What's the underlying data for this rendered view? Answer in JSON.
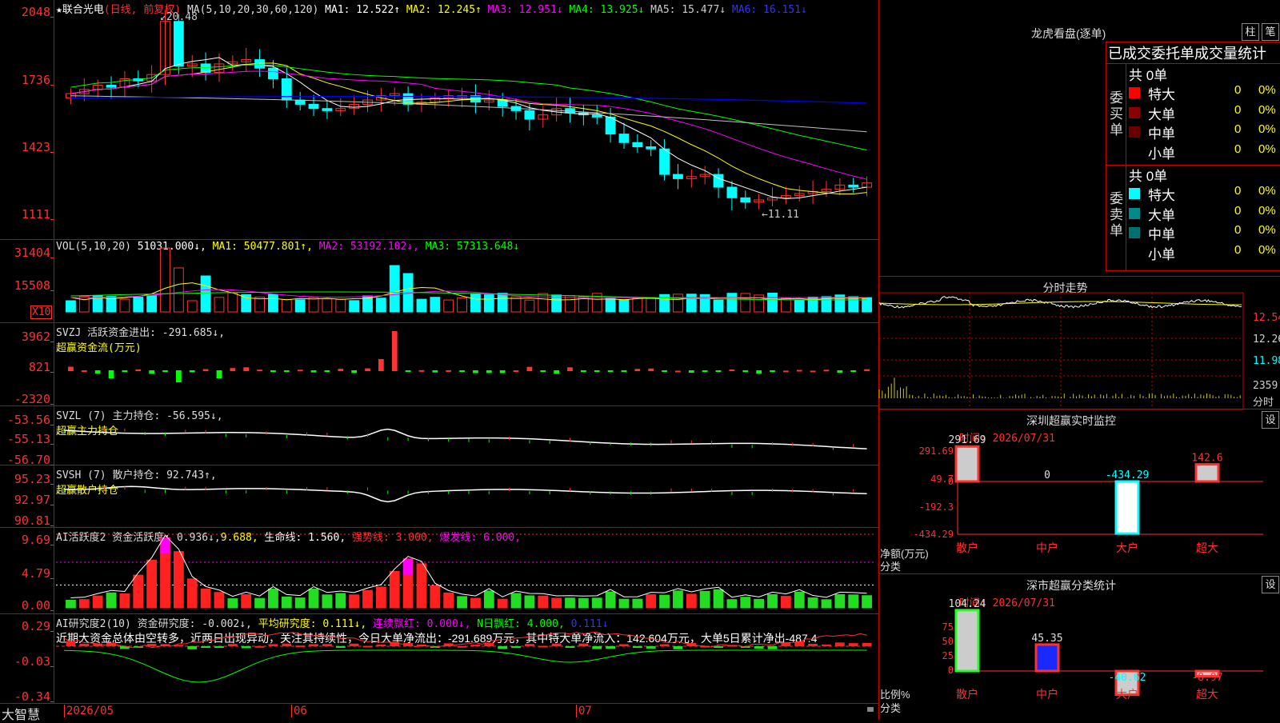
{
  "stock": {
    "name": "★联合光电",
    "period": "(日线, 前复权)",
    "ma_label": "MA(5,10,20,30,60,120)",
    "ma1": "MA1: 12.522↑",
    "ma2": "MA2: 12.245↑",
    "ma3": "MA3: 12.951↓",
    "ma4": "MA4: 13.925↓",
    "ma5": "MA5: 15.477↓",
    "ma6": "MA6: 16.151↓",
    "high_label": "20.48",
    "low_label": "11.11",
    "yticks": [
      "2048",
      "1736",
      "1423",
      "1111"
    ]
  },
  "vol": {
    "label": "VOL(5,10,20)",
    "value": "51031.000↓,",
    "ma1": "MA1: 50477.801↑,",
    "ma2": "MA2: 53192.102↓,",
    "ma3": "MA3: 57313.648↓",
    "yticks": [
      "31404",
      "15508"
    ],
    "unit": "X10"
  },
  "svzj": {
    "label": "SVZJ  活跃资金进出: -291.685↓,",
    "sub": "超赢资金流(万元)",
    "yticks": [
      "3962",
      "821",
      "-2320"
    ]
  },
  "svzl": {
    "label": "SVZL (7) 主力持仓: -56.595↓,",
    "sub": "超赢主力持仓",
    "yticks": [
      "-53.56",
      "-55.13",
      "-56.70"
    ]
  },
  "svsh": {
    "label": "SVSH (7) 散户持仓: 92.743↑,",
    "sub": "超赢散户持仓",
    "yticks": [
      "95.23",
      "92.97",
      "90.81"
    ]
  },
  "ai1": {
    "label": "AI活跃度2 资金活跃度: 0.936↓,",
    "v2": "9.688,",
    "life": "生命线: 1.560,",
    "strong": "强势线: 3.000,",
    "burst": "爆发线: 6.000,",
    "yticks": [
      "9.69",
      "4.79",
      "0.00"
    ]
  },
  "ai2": {
    "label": "AI研究度2(10) 资金研究度: -0.002↓,",
    "avg": "平均研究度: 0.111↓,",
    "cont": "连续飘红: 0.000↓,",
    "nday": "N日飘红: 4.000,",
    "v5": "0.111↓",
    "comment": "近期大资金总体由空转多，近两日出现异动，关注其持续性，今日大单净流出：-291.689万元，其中特大单净流入：142.604万元，大单5日累计净出-487.4",
    "yticks": [
      "0.29",
      "-0.03",
      "-0.34"
    ]
  },
  "bottom": {
    "brand": "大智慧",
    "dates": [
      "2026/05",
      "06",
      "07"
    ]
  },
  "lhb": {
    "title": "龙虎看盘(逐单)",
    "btn_zhu": "柱",
    "btn_bi": "笔",
    "subtitle": "已成交委托单成交量统计",
    "buy_label": "委买单",
    "sell_label": "委卖单",
    "buy_total": "共 0单",
    "sell_total": "共 0单",
    "buy_rows": [
      {
        "name": "特大",
        "color": "#ff0000",
        "v": "0",
        "p": "0%"
      },
      {
        "name": "大单",
        "color": "#8b0000",
        "v": "0",
        "p": "0%"
      },
      {
        "name": "中单",
        "color": "#6b0000",
        "v": "0",
        "p": "0%"
      },
      {
        "name": "小单",
        "color": "#000000",
        "v": "0",
        "p": "0%"
      }
    ],
    "sell_rows": [
      {
        "name": "特大",
        "color": "#00ffff",
        "v": "0",
        "p": "0%"
      },
      {
        "name": "大单",
        "color": "#008b8b",
        "v": "0",
        "p": "0%"
      },
      {
        "name": "中单",
        "color": "#007070",
        "v": "0",
        "p": "0%"
      },
      {
        "name": "小单",
        "color": "#000000",
        "v": "0",
        "p": "0%"
      }
    ]
  },
  "intraday": {
    "title": "分时走势",
    "yticks": [
      "12.54",
      "12.26",
      "11.98"
    ],
    "vol_tick": "2359",
    "vol_unit": "分时"
  },
  "sz_monitor": {
    "title": "深圳超赢实时监控",
    "btn": "设",
    "time": "时间: 2026/07/31",
    "yticks": [
      "291.69",
      "49.7",
      "0",
      "-192.3",
      "-434.29"
    ],
    "ylab1": "净额(万元)",
    "ylab2": "分类",
    "bars": [
      {
        "cat": "散户",
        "value": 291.69,
        "label": "291.69"
      },
      {
        "cat": "中户",
        "value": 0,
        "label": "0"
      },
      {
        "cat": "大户",
        "value": -434.29,
        "label": "-434.29"
      },
      {
        "cat": "超大",
        "value": 142.6,
        "label": "142.6"
      }
    ]
  },
  "sz_stats": {
    "title": "深市超赢分类统计",
    "btn": "设",
    "time": "时间: 2026/07/31",
    "yticks": [
      "75",
      "50",
      "25",
      "0"
    ],
    "ylab1": "比例%",
    "ylab2": "分类",
    "bars": [
      {
        "cat": "散户",
        "value": 104.24,
        "label": "104.24"
      },
      {
        "cat": "中户",
        "value": 45.35,
        "label": "45.35"
      },
      {
        "cat": "大户",
        "value": -40.62,
        "label": "-40.62"
      },
      {
        "cat": "超大",
        "value": -8.97,
        "label": "-8.97"
      }
    ]
  },
  "colors": {
    "up": "#ff3333",
    "down": "#00ffff",
    "ma1": "#ffffff",
    "ma2": "#ffff00",
    "ma3": "#ff00ff",
    "ma4": "#00ff00",
    "ma5": "#c0c0c0",
    "ma6": "#0000ff"
  }
}
